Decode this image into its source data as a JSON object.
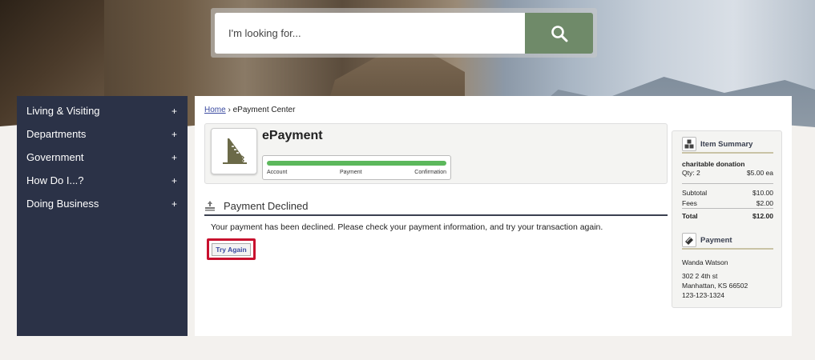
{
  "search": {
    "placeholder": "I'm looking for..."
  },
  "sidebar": {
    "items": [
      {
        "label": "Living & Visiting",
        "expand": "+"
      },
      {
        "label": "Departments",
        "expand": "+"
      },
      {
        "label": "Government",
        "expand": "+"
      },
      {
        "label": "How Do I...?",
        "expand": "+"
      },
      {
        "label": "Doing Business",
        "expand": "+"
      }
    ]
  },
  "breadcrumb": {
    "home": "Home",
    "separator": "›",
    "current": "ePayment Center"
  },
  "epayment": {
    "title": "ePayment",
    "progress": {
      "fraction": 1.0,
      "steps": [
        "Account",
        "Payment",
        "Confirmation"
      ]
    }
  },
  "declined": {
    "title": "Payment Declined",
    "message": "Your payment has been declined. Please check your payment information, and try your transaction again.",
    "try_again": "Try Again"
  },
  "summary": {
    "item_header": "Item Summary",
    "item_name": "charitable donation",
    "qty_label": "Qty:  2",
    "each_price": "$5.00 ea",
    "subtotal_label": "Subtotal",
    "subtotal_value": "$10.00",
    "fees_label": "Fees",
    "fees_value": "$2.00",
    "total_label": "Total",
    "total_value": "$12.00",
    "payment_header": "Payment",
    "payer_name": "Wanda Watson",
    "address_line1": "302 2 4th st",
    "address_line2": "Manhattan, KS 66502",
    "phone": "123-123-1324"
  },
  "colors": {
    "sidebar_bg": "#2b3247",
    "search_button": "#6f8a69",
    "progress_green": "#5cb85c",
    "highlight_red": "#c8102e",
    "link_blue": "#3a4aa0"
  }
}
